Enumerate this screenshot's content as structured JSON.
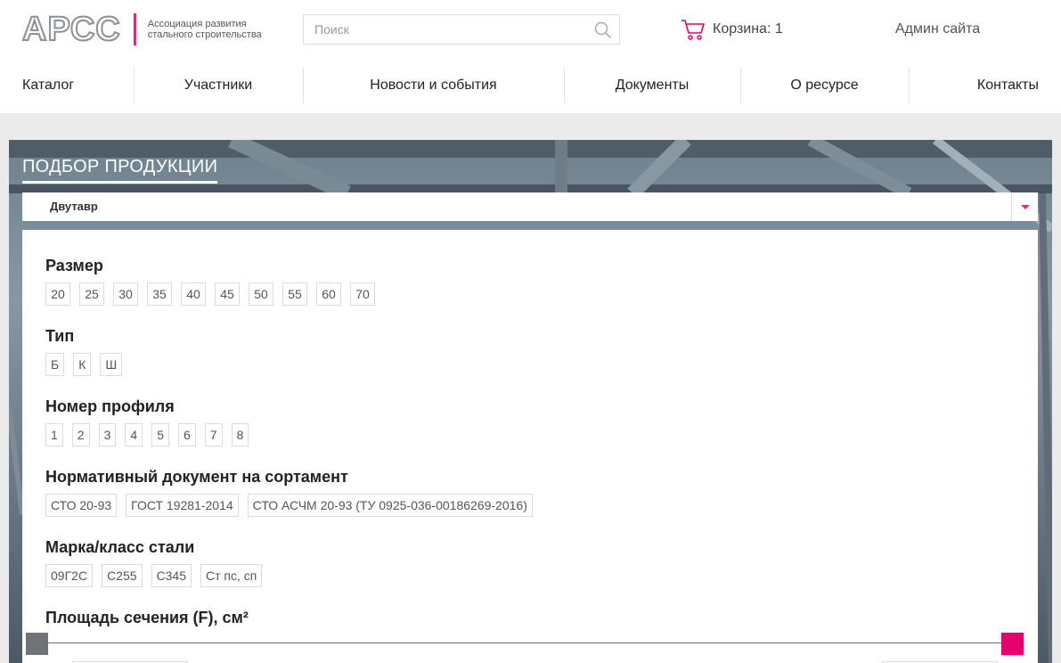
{
  "header": {
    "logo_mark": "АРСС",
    "logo_text": "Ассоциация развития стального строительства",
    "search_placeholder": "Поиск",
    "cart_label": "Корзина: 1",
    "admin_label": "Админ сайта"
  },
  "nav": [
    "Каталог",
    "Участники",
    "Новости и события",
    "Документы",
    "О ресурсе",
    "Контакты"
  ],
  "filter": {
    "title": "ПОДБОР ПРОДУКЦИИ",
    "selected_type": "Двутавр",
    "groups": [
      {
        "title": "Размер",
        "options": [
          "20",
          "25",
          "30",
          "35",
          "40",
          "45",
          "50",
          "55",
          "60",
          "70"
        ]
      },
      {
        "title": "Тип",
        "options": [
          "Б",
          "К",
          "Ш"
        ]
      },
      {
        "title": "Номер профиля",
        "options": [
          "1",
          "2",
          "3",
          "4",
          "5",
          "6",
          "7",
          "8"
        ]
      },
      {
        "title": "Нормативный документ на сортамент",
        "options": [
          "СТО 20-93",
          "ГОСТ 19281-2014",
          "СТО АСЧМ 20-93 (ТУ 0925-036-00186269-2016)"
        ]
      },
      {
        "title": "Марка/класс стали",
        "options": [
          "09Г2С",
          "С255",
          "С345",
          "Ст пс, сп"
        ]
      }
    ],
    "area_title": "Площадь сечения (F), см²"
  },
  "colors": {
    "accent": "#d6336c",
    "slider_right": "#e5006d",
    "slider_left": "#6f7378"
  }
}
